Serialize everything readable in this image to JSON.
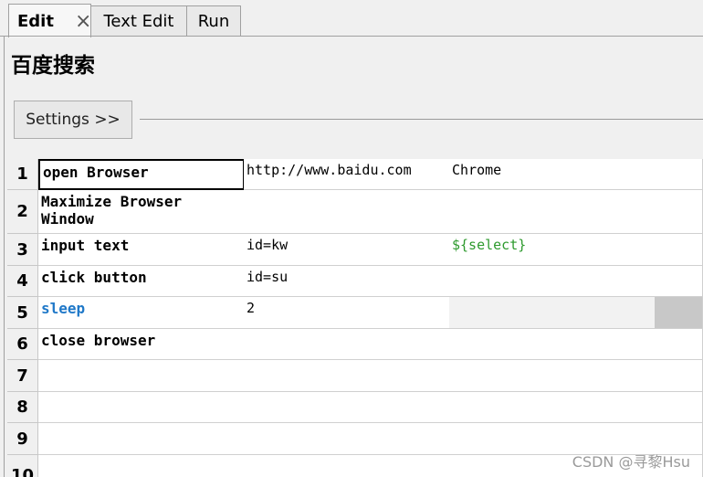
{
  "tabs": [
    {
      "label": "Edit",
      "active": true
    },
    {
      "label": "Text Edit",
      "active": false
    },
    {
      "label": "Run",
      "active": false
    }
  ],
  "tab_close_glyph": "×",
  "panel": {
    "title": "百度搜索",
    "settings_label": "Settings >>"
  },
  "grid": {
    "rows": [
      {
        "num": "1",
        "c1": "open Browser",
        "c2": "http://www.baidu.com",
        "c3": "Chrome"
      },
      {
        "num": "2",
        "c1": "Maximize Browser Window",
        "c2": "",
        "c3": ""
      },
      {
        "num": "3",
        "c1": "input text",
        "c2": "id=kw",
        "c3": "${select}"
      },
      {
        "num": "4",
        "c1": "click button",
        "c2": "id=su",
        "c3": ""
      },
      {
        "num": "5",
        "c1": "sleep",
        "c2": "2",
        "c3": ""
      },
      {
        "num": "6",
        "c1": "close browser",
        "c2": "",
        "c3": ""
      },
      {
        "num": "7",
        "c1": "",
        "c2": "",
        "c3": ""
      },
      {
        "num": "8",
        "c1": "",
        "c2": "",
        "c3": ""
      },
      {
        "num": "9",
        "c1": "",
        "c2": "",
        "c3": ""
      },
      {
        "num": "10",
        "c1": "",
        "c2": "",
        "c3": ""
      }
    ]
  },
  "colors": {
    "keyword_builtin": "#1f78c8",
    "variable": "#2e9a2e",
    "selection_border": "#000000"
  },
  "watermark": "CSDN @寻黎Hsu"
}
